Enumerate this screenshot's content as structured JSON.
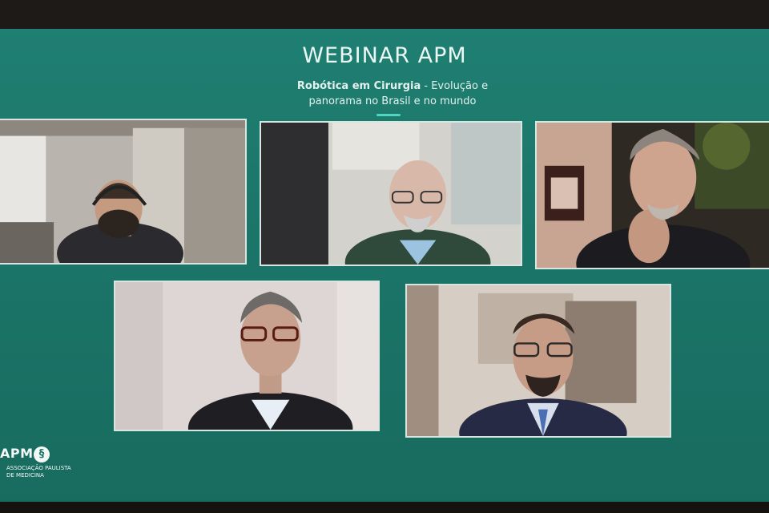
{
  "webinar": {
    "title": "WEBINAR APM",
    "subtitle_bold": "Robótica em Cirurgia",
    "subtitle_rest": " - Evolução e panorama no Brasil e no mundo"
  },
  "logo": {
    "name": "APM",
    "org_line1": "ASSOCIAÇÃO PAULISTA",
    "org_line2": "DE MEDICINA"
  },
  "participants": [
    {
      "id": "participant-1",
      "description_color": "#3a3a3c"
    },
    {
      "id": "participant-2",
      "description_color": "#2e4a3a"
    },
    {
      "id": "participant-3",
      "description_color": "#2a2a2e"
    },
    {
      "id": "participant-4",
      "description_color": "#26262a"
    },
    {
      "id": "participant-5",
      "description_color": "#2a3046"
    }
  ],
  "colors": {
    "background": "#1b7568",
    "accent": "#4fd6c2",
    "tile_border": "#d8e6e2"
  }
}
